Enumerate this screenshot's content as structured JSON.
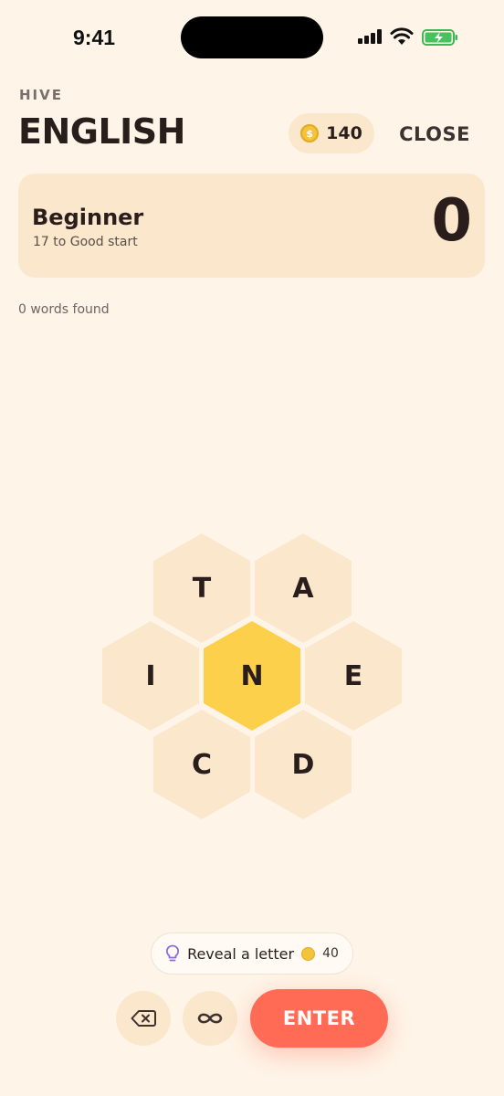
{
  "status": {
    "time": "9:41"
  },
  "header": {
    "section_label": "HIVE",
    "title": "ENGLISH",
    "coins": "140",
    "close_label": "CLOSE"
  },
  "rank": {
    "title": "Beginner",
    "subtitle": "17 to Good start",
    "score": "0"
  },
  "words_found": "0 words found",
  "hive": {
    "center_letter": "N",
    "outer_letters": {
      "top_left": "T",
      "top_right": "A",
      "left": "I",
      "right": "E",
      "bottom_left": "C",
      "bottom_right": "D"
    }
  },
  "controls": {
    "reveal_label": "Reveal a letter",
    "reveal_cost": "40",
    "enter_label": "ENTER",
    "delete_icon": "backspace-icon",
    "shuffle_icon": "infinity-icon"
  },
  "colors": {
    "background": "#FEF5E8",
    "card": "#FBE7CC",
    "center_hex": "#FDD04C",
    "enter": "#FF6B55",
    "text": "#2A1E1C"
  }
}
